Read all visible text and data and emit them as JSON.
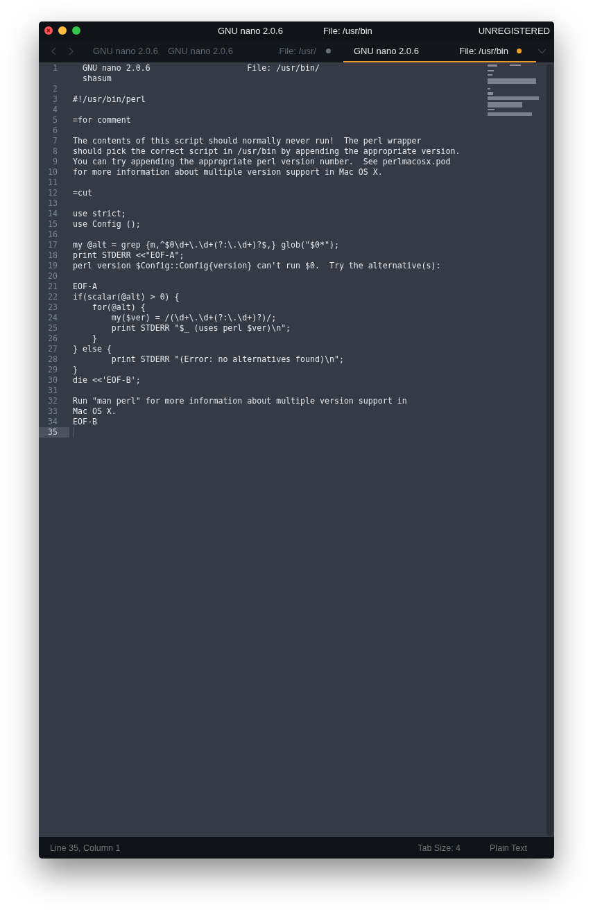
{
  "window": {
    "title": "GNU nano 2.0.6",
    "subtitle": "File: /usr/bin",
    "license": "UNREGISTERED"
  },
  "tabs": [
    {
      "title": "GNU nano 2.0.6",
      "selected": false,
      "dirty": false
    },
    {
      "title": "GNU nano 2.0.6",
      "path": "File: /usr/",
      "selected": false,
      "dirty": true
    },
    {
      "title": "GNU nano 2.0.6",
      "path": "File: /usr/bin",
      "selected": true,
      "dirty": true
    }
  ],
  "editor": {
    "lines": [
      {
        "number": "1",
        "text": "  GNU nano 2.0.6                    File: /usr/bin/\n  shasum",
        "current": false
      },
      {
        "number": "2",
        "current": false
      },
      {
        "number": "3",
        "text": "#!/usr/bin/perl",
        "current": false
      },
      {
        "number": "4",
        "current": false
      },
      {
        "number": "5",
        "text": "=for comment",
        "current": false
      },
      {
        "number": "6",
        "current": false
      },
      {
        "number": "7",
        "text": "The contents of this script should normally never run!  The perl wrapper",
        "current": false
      },
      {
        "number": "8",
        "text": "should pick the correct script in /usr/bin by appending the appropriate version.",
        "current": false
      },
      {
        "number": "9",
        "text": "You can try appending the appropriate perl version number.  See perlmacosx.pod",
        "current": false
      },
      {
        "number": "10",
        "text": "for more information about multiple version support in Mac OS X.",
        "current": false
      },
      {
        "number": "11",
        "current": false
      },
      {
        "number": "12",
        "text": "=cut",
        "current": false
      },
      {
        "number": "13",
        "current": false
      },
      {
        "number": "14",
        "text": "use strict;",
        "current": false
      },
      {
        "number": "15",
        "text": "use Config ();",
        "current": false
      },
      {
        "number": "16",
        "current": false
      },
      {
        "number": "17",
        "text": "my @alt = grep {m,^$0\\d+\\.\\d+(?:\\.\\d+)?$,} glob(\"$0*\");",
        "current": false
      },
      {
        "number": "18",
        "text": "print STDERR <<\"EOF-A\";",
        "current": false
      },
      {
        "number": "19",
        "text": "perl version $Config::Config{version} can't run $0.  Try the alternative(s):",
        "current": false
      },
      {
        "number": "20",
        "current": false
      },
      {
        "number": "21",
        "text": "EOF-A",
        "current": false
      },
      {
        "number": "22",
        "text": "if(scalar(@alt) > 0) {",
        "current": false
      },
      {
        "number": "23",
        "text": "    for(@alt) {",
        "current": false
      },
      {
        "number": "24",
        "text": "        my($ver) = /(\\d+\\.\\d+(?:\\.\\d+)?)/;",
        "current": false
      },
      {
        "number": "25",
        "text": "        print STDERR \"$_ (uses perl $ver)\\n\";",
        "current": false
      },
      {
        "number": "26",
        "text": "    }",
        "current": false
      },
      {
        "number": "27",
        "text": "} else {",
        "current": false
      },
      {
        "number": "28",
        "text": "        print STDERR \"(Error: no alternatives found)\\n\";",
        "current": false
      },
      {
        "number": "29",
        "text": "}",
        "current": false
      },
      {
        "number": "30",
        "text": "die <<'EOF-B';",
        "current": false
      },
      {
        "number": "31",
        "current": false
      },
      {
        "number": "32",
        "text": "Run \"man perl\" for more information about multiple version support in",
        "current": false
      },
      {
        "number": "33",
        "text": "Mac OS X.",
        "current": false
      },
      {
        "number": "34",
        "text": "EOF-B",
        "current": false
      },
      {
        "number": "35",
        "current": true
      }
    ]
  },
  "status_bar": {
    "position": "Line 35, Column 1",
    "tab_size": "Tab Size: 4",
    "syntax": "Plain Text"
  }
}
